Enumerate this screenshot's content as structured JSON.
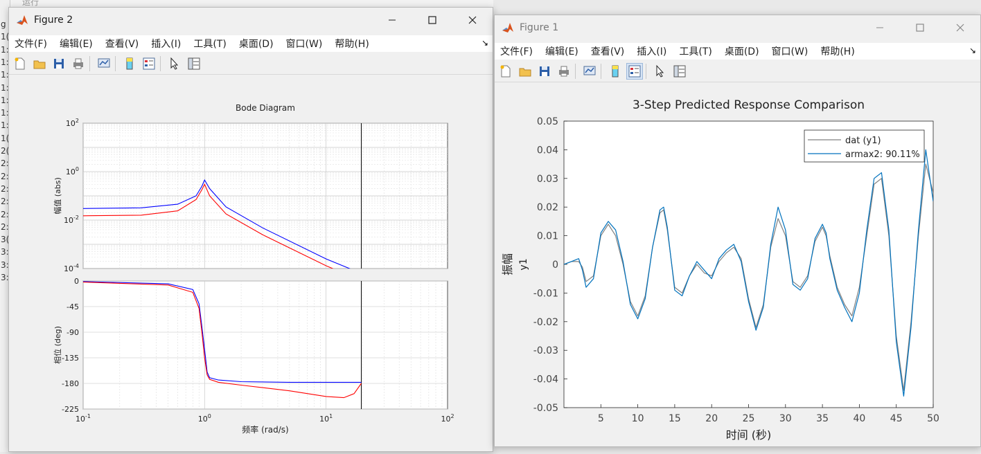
{
  "desktop": {
    "top_text": "运行",
    "left_glyphs": [
      "g",
      "1(",
      "1:",
      "1:",
      "1:",
      "1:",
      "1:",
      "1:",
      "1:",
      "1(",
      "2(",
      "2:",
      "2:",
      "2:",
      "2:",
      "2:",
      "2:",
      "3(",
      "3:",
      "3:",
      "3:"
    ]
  },
  "figure2": {
    "title": "Figure 2",
    "menu": [
      "文件(F)",
      "编辑(E)",
      "查看(V)",
      "插入(I)",
      "工具(T)",
      "桌面(D)",
      "窗口(W)",
      "帮助(H)"
    ],
    "toolbar_icons": [
      "new-figure-icon",
      "open-file-icon",
      "save-icon",
      "print-icon",
      "link-plot-icon",
      "colorbar-icon",
      "legend-icon",
      "pointer-icon",
      "property-inspector-icon"
    ],
    "chart_data": {
      "type": "line",
      "title": "Bode Diagram",
      "xlabel": "频率  (rad/s)",
      "xscale": "log",
      "xlim": [
        0.1,
        100
      ],
      "x_ticks": [
        "10-1",
        "100",
        "101",
        "102"
      ],
      "magnitude": {
        "ylabel": "幅值 (abs)",
        "yscale": "log",
        "ylim": [
          0.0001,
          100
        ],
        "y_ticks": [
          "102",
          "100",
          "10-2",
          "10-4"
        ],
        "series": [
          {
            "color": "#0000ff",
            "x": [
              0.1,
              0.3,
              0.6,
              0.85,
              0.95,
              1.0,
              1.1,
              1.5,
              3,
              10,
              20
            ],
            "y": [
              0.03,
              0.032,
              0.045,
              0.1,
              0.25,
              0.45,
              0.2,
              0.035,
              0.0048,
              0.00025,
              6e-05
            ]
          },
          {
            "color": "#ff0000",
            "x": [
              0.1,
              0.3,
              0.6,
              0.85,
              0.95,
              1.0,
              1.1,
              1.5,
              3,
              10,
              20
            ],
            "y": [
              0.015,
              0.016,
              0.024,
              0.07,
              0.18,
              0.3,
              0.1,
              0.018,
              0.0025,
              0.00013,
              3e-05
            ]
          }
        ]
      },
      "phase": {
        "ylabel": "相位 (deg)",
        "ylim": [
          -225,
          0
        ],
        "y_ticks": [
          0,
          -45,
          -90,
          -135,
          -180,
          -225
        ],
        "series": [
          {
            "color": "#0000ff",
            "x": [
              0.1,
              0.5,
              0.8,
              0.9,
              0.95,
              1.0,
              1.05,
              1.1,
              1.3,
              2,
              5,
              10,
              19.5
            ],
            "y": [
              -1,
              -5,
              -15,
              -40,
              -80,
              -120,
              -160,
              -170,
              -174,
              -177,
              -178,
              -178,
              -178
            ]
          },
          {
            "color": "#ff0000",
            "x": [
              0.1,
              0.5,
              0.8,
              0.9,
              0.95,
              1.0,
              1.05,
              1.1,
              1.3,
              2,
              5,
              10,
              14,
              17,
              19.5
            ],
            "y": [
              -2,
              -7,
              -20,
              -48,
              -90,
              -135,
              -165,
              -173,
              -178,
              -183,
              -193,
              -203,
              -205,
              -198,
              -180
            ]
          }
        ]
      }
    }
  },
  "figure1": {
    "title": "Figure 1",
    "menu": [
      "文件(F)",
      "编辑(E)",
      "查看(V)",
      "插入(I)",
      "工具(T)",
      "桌面(D)",
      "窗口(W)",
      "帮助(H)"
    ],
    "toolbar_icons": [
      "new-figure-icon",
      "open-file-icon",
      "save-icon",
      "print-icon",
      "link-plot-icon",
      "colorbar-icon",
      "legend-icon",
      "pointer-icon",
      "property-inspector-icon"
    ],
    "chart_data": {
      "type": "line",
      "title": "3-Step Predicted Response Comparison",
      "xlabel": "时间 (秒)",
      "ylabel": "振幅",
      "ylabel2": "y1",
      "xlim": [
        0,
        50
      ],
      "ylim": [
        -0.05,
        0.05
      ],
      "x_ticks": [
        5,
        10,
        15,
        20,
        25,
        30,
        35,
        40,
        45,
        50
      ],
      "y_ticks": [
        "0.05",
        "0.04",
        "0.03",
        "0.02",
        "0.01",
        "0",
        "-0.01",
        "-0.02",
        "-0.03",
        "-0.04",
        "-0.05"
      ],
      "legend": [
        "dat (y1)",
        "armax2: 90.11%"
      ],
      "legend_position": "top-right",
      "series": [
        {
          "name": "dat (y1)",
          "color": "#808080",
          "x": [
            0,
            1,
            2,
            2.5,
            3,
            4,
            5,
            6,
            7,
            8,
            9,
            10,
            11,
            12,
            13,
            13.5,
            14,
            15,
            16,
            17,
            18,
            19,
            20,
            21,
            22,
            23,
            24,
            25,
            26,
            27,
            28,
            29,
            30,
            31,
            32,
            33,
            34,
            35,
            35.5,
            36,
            37,
            38,
            39,
            40,
            41,
            42,
            43,
            44,
            45,
            46,
            47,
            48,
            49,
            50
          ],
          "y": [
            0,
            0.001,
            0.001,
            -0.001,
            -0.006,
            -0.004,
            0.01,
            0.014,
            0.01,
            0,
            -0.013,
            -0.018,
            -0.011,
            0.006,
            0.018,
            0.019,
            0.012,
            -0.008,
            -0.01,
            -0.004,
            0,
            -0.003,
            -0.004,
            0.001,
            0.004,
            0.006,
            0.002,
            -0.012,
            -0.022,
            -0.014,
            0.006,
            0.016,
            0.01,
            -0.006,
            -0.008,
            -0.004,
            0.008,
            0.013,
            0.01,
            0.003,
            -0.008,
            -0.014,
            -0.018,
            -0.008,
            0.01,
            0.028,
            0.03,
            0.01,
            -0.025,
            -0.044,
            -0.02,
            0.01,
            0.035,
            0.025
          ]
        },
        {
          "name": "armax2: 90.11%",
          "color": "#0072bd",
          "x": [
            0,
            1,
            2,
            2.5,
            3,
            4,
            5,
            6,
            7,
            8,
            9,
            10,
            11,
            12,
            13,
            13.5,
            14,
            15,
            16,
            17,
            18,
            19,
            20,
            21,
            22,
            23,
            24,
            25,
            26,
            27,
            28,
            29,
            30,
            31,
            32,
            33,
            34,
            35,
            35.5,
            36,
            37,
            38,
            39,
            40,
            41,
            42,
            43,
            44,
            45,
            46,
            47,
            48,
            49,
            50
          ],
          "y": [
            0,
            0.001,
            0.002,
            -0.002,
            -0.008,
            -0.005,
            0.011,
            0.015,
            0.012,
            0.001,
            -0.014,
            -0.019,
            -0.012,
            0.006,
            0.019,
            0.02,
            0.013,
            -0.009,
            -0.011,
            -0.004,
            0.001,
            -0.002,
            -0.005,
            0.002,
            0.005,
            0.007,
            0.001,
            -0.013,
            -0.023,
            -0.015,
            0.007,
            0.02,
            0.012,
            -0.007,
            -0.009,
            -0.005,
            0.009,
            0.014,
            0.011,
            0.002,
            -0.009,
            -0.015,
            -0.02,
            -0.01,
            0.012,
            0.03,
            0.032,
            0.012,
            -0.027,
            -0.046,
            -0.022,
            0.012,
            0.04,
            0.022
          ]
        }
      ]
    }
  }
}
